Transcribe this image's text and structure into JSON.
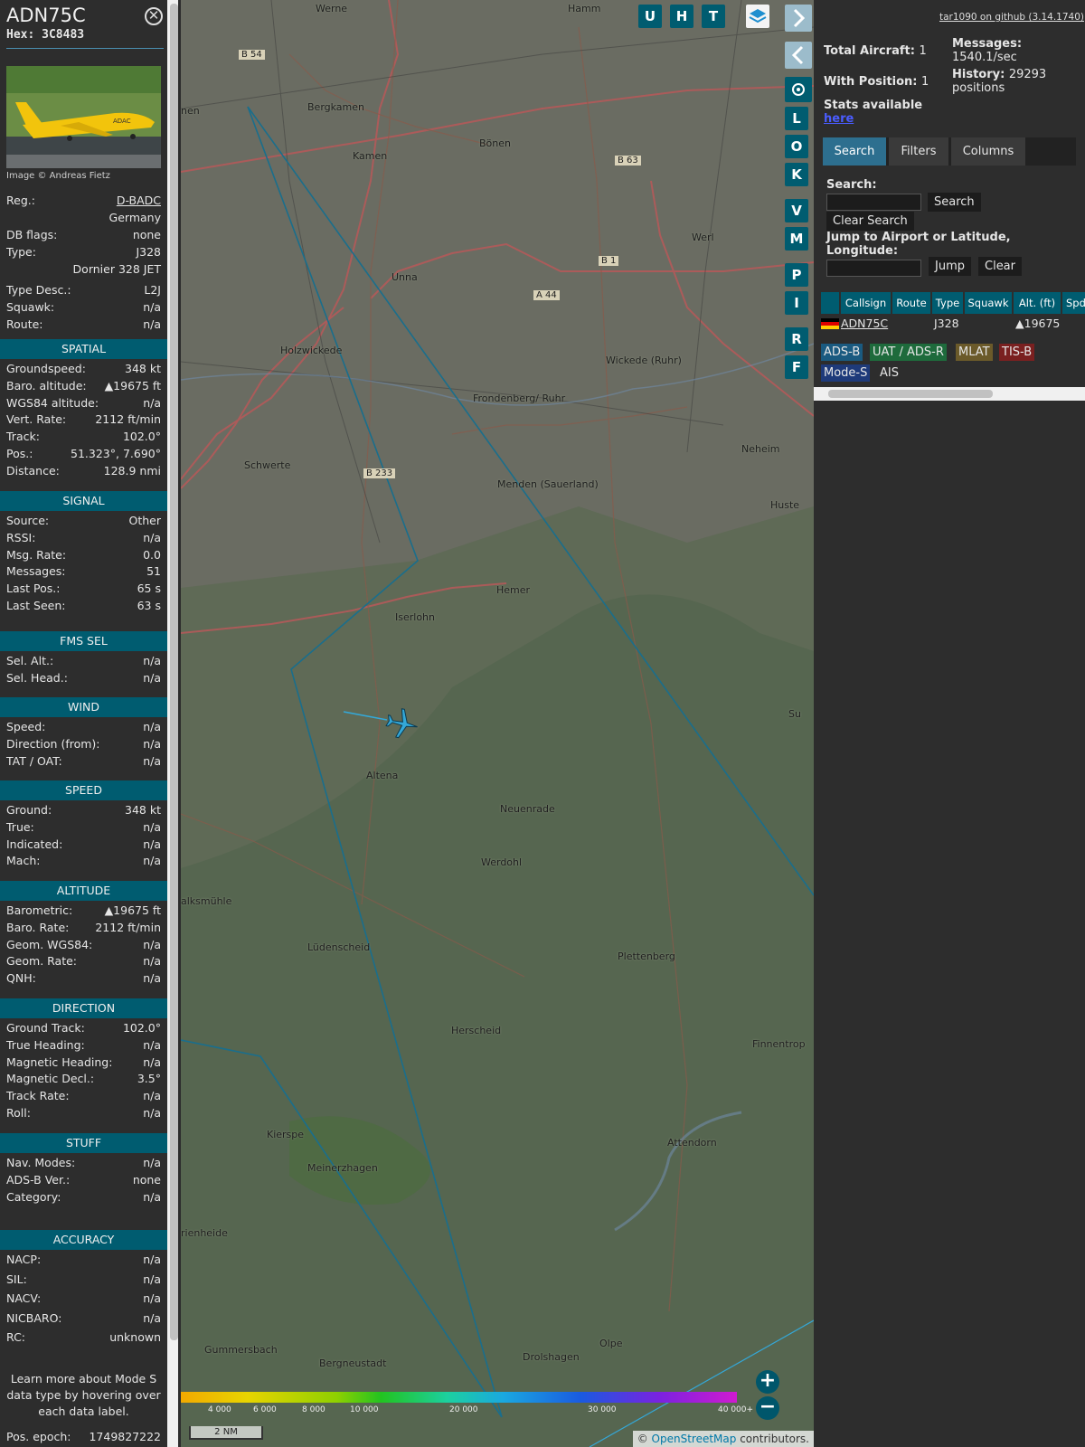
{
  "aircraft": {
    "callsign": "ADN75C",
    "hex_line": "Hex: 3C8483",
    "photo_credit": "Image © Andreas Fietz",
    "reg_label": "Reg.:",
    "reg": "D-BADC",
    "country": "Germany",
    "dbflags_label": "DB flags:",
    "dbflags": "none",
    "type_label": "Type:",
    "type": "J328",
    "type_full": "Dornier 328 JET",
    "typedesc_label": "Type Desc.:",
    "typedesc": "L2J",
    "squawk_label": "Squawk:",
    "squawk": "n/a",
    "route_label": "Route:",
    "route": "n/a"
  },
  "sections": {
    "spatial": "SPATIAL",
    "signal": "SIGNAL",
    "fms": "FMS SEL",
    "wind": "WIND",
    "speed": "SPEED",
    "altitude": "ALTITUDE",
    "direction": "DIRECTION",
    "stuff": "STUFF",
    "accuracy": "ACCURACY"
  },
  "spatial": [
    {
      "k": "Groundspeed:",
      "v": "348 kt"
    },
    {
      "k": "Baro. altitude:",
      "v": "▲19675 ft"
    },
    {
      "k": "WGS84 altitude:",
      "v": "n/a"
    },
    {
      "k": "Vert. Rate:",
      "v": "2112 ft/min"
    },
    {
      "k": "Track:",
      "v": "102.0°"
    },
    {
      "k": "Pos.:",
      "v": "51.323°, 7.690°"
    },
    {
      "k": "Distance:",
      "v": "128.9 nmi"
    }
  ],
  "signal": [
    {
      "k": "Source:",
      "v": "Other"
    },
    {
      "k": "RSSI:",
      "v": "n/a"
    },
    {
      "k": "Msg. Rate:",
      "v": "0.0"
    },
    {
      "k": "Messages:",
      "v": "51"
    },
    {
      "k": "Last Pos.:",
      "v": "65 s"
    },
    {
      "k": "Last Seen:",
      "v": "63 s"
    }
  ],
  "fms": [
    {
      "k": "Sel. Alt.:",
      "v": "n/a"
    },
    {
      "k": "Sel. Head.:",
      "v": "n/a"
    }
  ],
  "wind": [
    {
      "k": "Speed:",
      "v": "n/a"
    },
    {
      "k": "Direction (from):",
      "v": "n/a"
    },
    {
      "k": "TAT / OAT:",
      "v": "n/a"
    }
  ],
  "speed": [
    {
      "k": "Ground:",
      "v": "348 kt"
    },
    {
      "k": "True:",
      "v": "n/a"
    },
    {
      "k": "Indicated:",
      "v": "n/a"
    },
    {
      "k": "Mach:",
      "v": "n/a"
    }
  ],
  "altitude": [
    {
      "k": "Barometric:",
      "v": "▲19675 ft"
    },
    {
      "k": "Baro. Rate:",
      "v": "2112 ft/min"
    },
    {
      "k": "Geom. WGS84:",
      "v": "n/a"
    },
    {
      "k": "Geom. Rate:",
      "v": "n/a"
    },
    {
      "k": "QNH:",
      "v": "n/a"
    }
  ],
  "direction": [
    {
      "k": "Ground Track:",
      "v": "102.0°"
    },
    {
      "k": "True Heading:",
      "v": "n/a"
    },
    {
      "k": "Magnetic Heading:",
      "v": "n/a"
    },
    {
      "k": "Magnetic Decl.:",
      "v": "3.5°"
    },
    {
      "k": "Track Rate:",
      "v": "n/a"
    },
    {
      "k": "Roll:",
      "v": "n/a"
    }
  ],
  "stuff": [
    {
      "k": "Nav. Modes:",
      "v": "n/a"
    },
    {
      "k": "ADS-B Ver.:",
      "v": "none"
    },
    {
      "k": "Category:",
      "v": "n/a"
    }
  ],
  "accuracy": [
    {
      "k": "NACP:",
      "v": "n/a"
    },
    {
      "k": "SIL:",
      "v": "n/a"
    },
    {
      "k": "NACV:",
      "v": "n/a"
    },
    {
      "k": "NICBARO:",
      "v": "n/a"
    },
    {
      "k": "RC:",
      "v": "unknown"
    }
  ],
  "footer_note": "Learn more about Mode S data type by hovering over each data label.",
  "pos_epoch": {
    "k": "Pos. epoch:",
    "v": "1749827222"
  },
  "map": {
    "top_buttons": [
      "U",
      "H",
      "T"
    ],
    "side_buttons": [
      "L",
      "O",
      "K",
      "V",
      "M",
      "P",
      "I",
      "R",
      "F"
    ],
    "zoom_in": "+",
    "zoom_out": "−",
    "scale": "2 NM",
    "attribution_prefix": "© ",
    "attribution_link": "OpenStreetMap",
    "attribution_suffix": " contributors.",
    "color_scale_labels": [
      "4 000",
      "6 000",
      "8 000",
      "10 000",
      "20 000",
      "30 000",
      "40 000+"
    ],
    "places": [
      "Werne",
      "Hamm",
      "Bergkamen",
      "Kamen",
      "Bönen",
      "Unna",
      "Werl",
      "Holzwickede",
      "Wickede (Ruhr)",
      "Frondenberg/ Ruhr",
      "Schwerte",
      "Menden (Sauerland)",
      "Neheim",
      "Hemer",
      "Iserlohn",
      "Altena",
      "Neuenrade",
      "Werdohl",
      "Lüdenscheid",
      "Plettenberg",
      "Herscheid",
      "Finnentrop",
      "Attendorn",
      "Kierspe",
      "Meinerzhagen",
      "Gummersbach",
      "Bergneustadt",
      "Drolshagen",
      "Olpe",
      "nen",
      "alksmühle",
      "rienheide",
      "Huste",
      "Su"
    ],
    "road_labels": [
      "B 54",
      "B 63",
      "B 1",
      "A 44",
      "B 233"
    ]
  },
  "right": {
    "github": "tar1090 on github (3.14.1740)",
    "total_aircraft_label": "Total Aircraft:",
    "total_aircraft": "1",
    "with_position_label": "With Position:",
    "with_position": "1",
    "messages_label": "Messages:",
    "messages": "1540.1/sec",
    "history_label": "History:",
    "history": "29293 positions",
    "stats_label": "Stats available",
    "stats_link": "here",
    "tabs": [
      "Search",
      "Filters",
      "Columns"
    ],
    "search_label": "Search:",
    "search_button": "Search",
    "clear_search_button": "Clear Search",
    "jump_label": "Jump to Airport or Latitude, Longitude:",
    "jump_button": "Jump",
    "clear_button": "Clear",
    "table_headers": [
      "Callsign",
      "Route",
      "Type",
      "Squawk",
      "Alt. (ft)",
      "Spd"
    ],
    "table_row": {
      "callsign": "ADN75C",
      "type": "J328",
      "alt": "▲19675"
    },
    "sources": [
      "ADS-B",
      "UAT / ADS-R",
      "MLAT",
      "TIS-B",
      "Mode-S",
      "AIS"
    ],
    "source_colors": [
      "#1a5a80",
      "#1e6b3c",
      "#6b5a2a",
      "#7a2020",
      "#1e3a7a",
      "#2d2d2d"
    ]
  },
  "colors": {
    "section_bg": "#005c70",
    "track_line": "#1a6e8c",
    "aircraft_icon": "#34a8d8"
  }
}
